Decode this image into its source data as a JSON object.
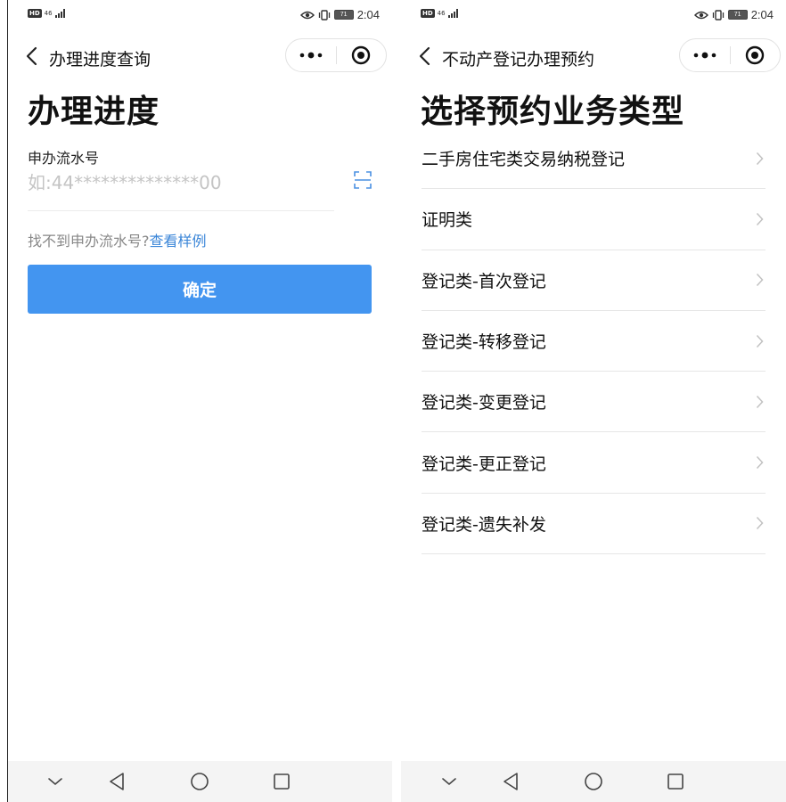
{
  "status_bar": {
    "network": "46",
    "hd": "HD",
    "battery": "71",
    "time": "2:04"
  },
  "left": {
    "nav_title": "办理进度查询",
    "heading": "办理进度",
    "field_label": "申办流水号",
    "field_placeholder": "如:44**************00",
    "hint_text": "找不到申办流水号?",
    "hint_link": "查看样例",
    "confirm_label": "确定"
  },
  "right": {
    "nav_title": "不动产登记办理预约",
    "heading": "选择预约业务类型",
    "items": [
      "二手房住宅类交易纳税登记",
      "证明类",
      "登记类-首次登记",
      "登记类-转移登记",
      "登记类-变更登记",
      "登记类-更正登记",
      "登记类-遗失补发"
    ]
  },
  "icons": {
    "back": "chevron-left-icon",
    "more": "more-dots-icon",
    "close": "target-circle-icon",
    "scan": "scan-frame-icon",
    "list_chevron": "chevron-right-icon",
    "sys_down": "chevron-down-icon",
    "sys_back": "triangle-back-icon",
    "sys_home": "circle-home-icon",
    "sys_recent": "square-recent-icon"
  },
  "colors": {
    "primary_button": "#4395f0",
    "link": "#3b86d8",
    "placeholder": "#c4c4c4",
    "divider": "#e6e6e6"
  }
}
